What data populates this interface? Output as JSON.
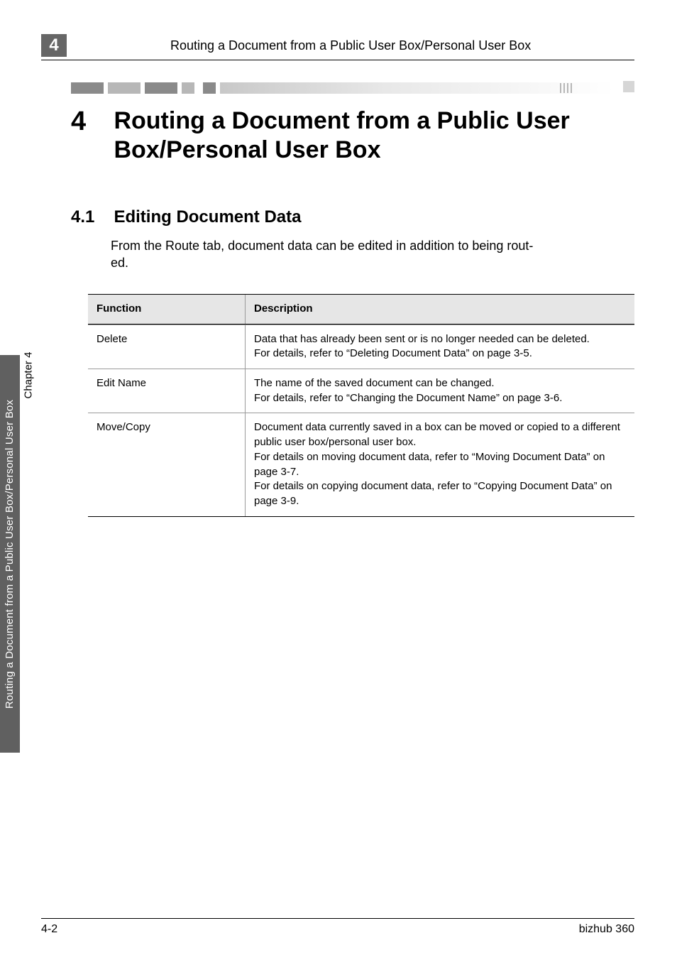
{
  "chapter_badge": "4",
  "running_head": "Routing a Document from a Public User Box/Personal User Box",
  "main": {
    "num": "4",
    "title": "Routing a Document from a Public User Box/Personal User Box"
  },
  "section": {
    "num": "4.1",
    "title": "Editing Document Data"
  },
  "body_line1": "From the Route tab, document data can be edited in addition to being rout-",
  "body_line2": "ed.",
  "table": {
    "headers": {
      "c1": "Function",
      "c2": "Description"
    },
    "rows": [
      {
        "c1": "Delete",
        "c2": "Data that has already been sent or is no longer needed can be deleted.\nFor details, refer to “Deleting Document Data” on page 3-5."
      },
      {
        "c1": "Edit Name",
        "c2": "The name of the saved document can be changed.\nFor details, refer to “Changing the Document Name” on page 3-6."
      },
      {
        "c1": "Move/Copy",
        "c2": "Document data currently saved in a box can be moved or copied to a different public user box/personal user box.\nFor details on moving document data, refer to “Moving Document Data” on page 3-7.\nFor details on copying document data, refer to “Copying Document Data” on page 3-9."
      }
    ]
  },
  "side": {
    "chapter": "Chapter 4",
    "text": "Routing a Document from a Public User Box/Personal User Box"
  },
  "footer": {
    "left": "4-2",
    "right": "bizhub 360"
  }
}
